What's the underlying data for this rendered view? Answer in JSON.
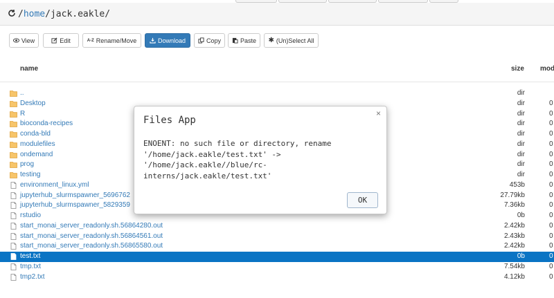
{
  "path": {
    "prefix": "/",
    "home_link": "home",
    "rest": "/jack.eakle/"
  },
  "toolbar": {
    "view": "View",
    "edit": "Edit",
    "rename_icon_text": "A-Z",
    "rename": "Rename/Move",
    "download": "Download",
    "copy": "Copy",
    "paste": "Paste",
    "select_all": "(Un)Select All"
  },
  "table": {
    "headers": {
      "name": "name",
      "size": "size",
      "modified": "mod"
    },
    "rows": [
      {
        "name": "..",
        "size": "dir",
        "mod": "",
        "type": "folder"
      },
      {
        "name": "Desktop",
        "size": "dir",
        "mod": "0",
        "type": "folder"
      },
      {
        "name": "R",
        "size": "dir",
        "mod": "0",
        "type": "folder"
      },
      {
        "name": "bioconda-recipes",
        "size": "dir",
        "mod": "0",
        "type": "folder"
      },
      {
        "name": "conda-bld",
        "size": "dir",
        "mod": "0",
        "type": "folder"
      },
      {
        "name": "modulefiles",
        "size": "dir",
        "mod": "0",
        "type": "folder"
      },
      {
        "name": "ondemand",
        "size": "dir",
        "mod": "0",
        "type": "folder"
      },
      {
        "name": "prog",
        "size": "dir",
        "mod": "0",
        "type": "folder"
      },
      {
        "name": "testing",
        "size": "dir",
        "mod": "0",
        "type": "folder"
      },
      {
        "name": "environment_linux.yml",
        "size": "453b",
        "mod": "0",
        "type": "file"
      },
      {
        "name": "jupyterhub_slurmspawner_5696762",
        "size": "27.79kb",
        "mod": "0",
        "type": "file"
      },
      {
        "name": "jupyterhub_slurmspawner_5829359",
        "size": "7.36kb",
        "mod": "0",
        "type": "file"
      },
      {
        "name": "rstudio",
        "size": "0b",
        "mod": "0",
        "type": "file"
      },
      {
        "name": "start_monai_server_readonly.sh.56864280.out",
        "size": "2.42kb",
        "mod": "0",
        "type": "file"
      },
      {
        "name": "start_monai_server_readonly.sh.56864561.out",
        "size": "2.43kb",
        "mod": "0",
        "type": "file"
      },
      {
        "name": "start_monai_server_readonly.sh.56865580.out",
        "size": "2.42kb",
        "mod": "0",
        "type": "file"
      },
      {
        "name": "test.txt",
        "size": "0b",
        "mod": "0",
        "type": "file",
        "selected": true
      },
      {
        "name": "tmp.txt",
        "size": "7.54kb",
        "mod": "0",
        "type": "file"
      },
      {
        "name": "tmp2.txt",
        "size": "4.12kb",
        "mod": "0",
        "type": "file"
      }
    ]
  },
  "dialog": {
    "title": "Files App",
    "close": "×",
    "message": "ENOENT: no such file or directory, rename '/home/jack.eakle/test.txt' -> '/home/jack.eakle//blue/rc-interns/jack.eakle/test.txt'",
    "ok": "OK"
  },
  "colors": {
    "link": "#337ab7",
    "primary": "#337ab7",
    "selected_row": "#0a74c4",
    "folder": "#f0ad4e"
  }
}
